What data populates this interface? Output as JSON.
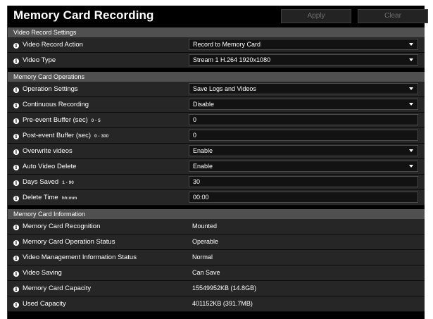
{
  "header": {
    "title": "Memory Card Recording",
    "apply_label": "Apply",
    "clear_label": "Clear"
  },
  "sections": {
    "video_record": {
      "title": "Video Record Settings",
      "rows": [
        {
          "label": "Video Record Action",
          "value": "Record to Memory Card"
        },
        {
          "label": "Video Type",
          "value": "Stream 1 H.264 1920x1080"
        }
      ]
    },
    "operations": {
      "title": "Memory Card Operations",
      "rows": [
        {
          "label": "Operation Settings",
          "value": "Save Logs and Videos"
        },
        {
          "label": "Continuous Recording",
          "value": "Disable"
        },
        {
          "label": "Pre-event Buffer (sec)",
          "range": "0 - 5",
          "value": "0"
        },
        {
          "label": "Post-event Buffer (sec)",
          "range": "0 - 300",
          "value": "0"
        },
        {
          "label": "Overwrite videos",
          "value": "Enable"
        },
        {
          "label": "Auto Video Delete",
          "value": "Enable"
        },
        {
          "label": "Days Saved",
          "range": "1 - 90",
          "value": "30"
        },
        {
          "label": "Delete Time",
          "range": "hh:mm",
          "value": "00:00"
        }
      ]
    },
    "information": {
      "title": "Memory Card Information",
      "rows": [
        {
          "label": "Memory Card Recognition",
          "value": "Mounted"
        },
        {
          "label": "Memory Card Operation Status",
          "value": "Operable"
        },
        {
          "label": "Video Management Information Status",
          "value": "Normal"
        },
        {
          "label": "Video Saving",
          "value": "Can Save"
        },
        {
          "label": "Memory Card Capacity",
          "value": "15549952KB (14.8GB)"
        },
        {
          "label": "Used Capacity",
          "value": "401152KB (391.7MB)"
        }
      ]
    }
  },
  "info_icon_glyph": "i",
  "colors": {
    "background": "#000000",
    "row": "#262626",
    "section_header": "#505050",
    "field": "#121212"
  }
}
